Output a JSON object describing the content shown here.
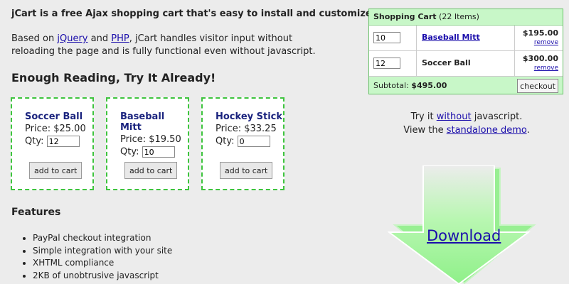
{
  "intro": {
    "headline": "jCart is a free Ajax shopping cart that's easy to install and customize.",
    "para_prefix": "Based on ",
    "link_jquery": "jQuery",
    "and": " and ",
    "link_php": "PHP",
    "para_suffix": ", jCart handles visitor input without reloading the page and is fully functional even without javascript."
  },
  "section_title": "Enough Reading, Try It Already!",
  "products": [
    {
      "name": "Soccer Ball",
      "price": "Price: $25.00",
      "qty_label": "Qty:",
      "qty": "12",
      "button": "add to cart"
    },
    {
      "name": "Baseball Mitt",
      "price": "Price: $19.50",
      "qty_label": "Qty:",
      "qty": "10",
      "button": "add to cart"
    },
    {
      "name": "Hockey Stick",
      "price": "Price: $33.25",
      "qty_label": "Qty:",
      "qty": "0",
      "button": "add to cart"
    }
  ],
  "features": {
    "title": "Features",
    "items": [
      "PayPal checkout integration",
      "Simple integration with your site",
      "XHTML compliance",
      "2KB of unobtrusive javascript"
    ]
  },
  "cart": {
    "title": "Shopping Cart",
    "count": "(22 Items)",
    "items": [
      {
        "qty": "10",
        "name": "Baseball Mitt",
        "price": "$195.00",
        "remove": "remove",
        "linked": true
      },
      {
        "qty": "12",
        "name": "Soccer Ball",
        "price": "$300.00",
        "remove": "remove",
        "linked": false
      }
    ],
    "subtotal_label": "Subtotal:",
    "subtotal": "$495.00",
    "checkout": "checkout"
  },
  "try": {
    "line1_prefix": "Try it ",
    "line1_link": "without",
    "line1_suffix": " javascript.",
    "line2_prefix": "View the ",
    "line2_link": "standalone demo",
    "line2_suffix": "."
  },
  "download": {
    "label": "Download"
  },
  "colors": {
    "accent_green": "#3ec43e",
    "cart_bg": "#c8f7c8",
    "link": "#1a0dab",
    "arrow_fill": "#a8f7a0"
  }
}
